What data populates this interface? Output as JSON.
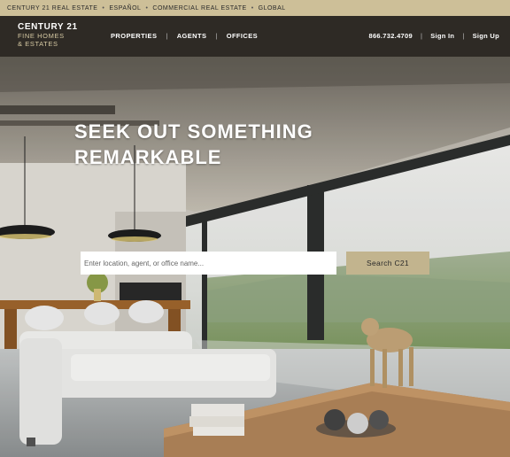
{
  "topbar": {
    "links": [
      "CENTURY 21 REAL ESTATE",
      "ESPAÑOL",
      "COMMERCIAL REAL ESTATE",
      "GLOBAL"
    ],
    "separator": "•"
  },
  "header": {
    "logo": {
      "line1": "CENTURY 21",
      "line2": "FINE HOMES",
      "line3": "& ESTATES"
    },
    "nav": [
      "PROPERTIES",
      "AGENTS",
      "OFFICES"
    ],
    "phone": "866.732.4709",
    "sign_in": "Sign In",
    "sign_up": "Sign Up",
    "separator": "|"
  },
  "hero": {
    "headline": "SEEK OUT SOMETHING\nREMARKABLE",
    "search": {
      "placeholder": "Enter location, agent, or office name...",
      "button_label": "Search C21"
    }
  },
  "colors": {
    "topbar": "#cdbf98",
    "header": "#2e2a25",
    "button": "#c2b48e"
  }
}
